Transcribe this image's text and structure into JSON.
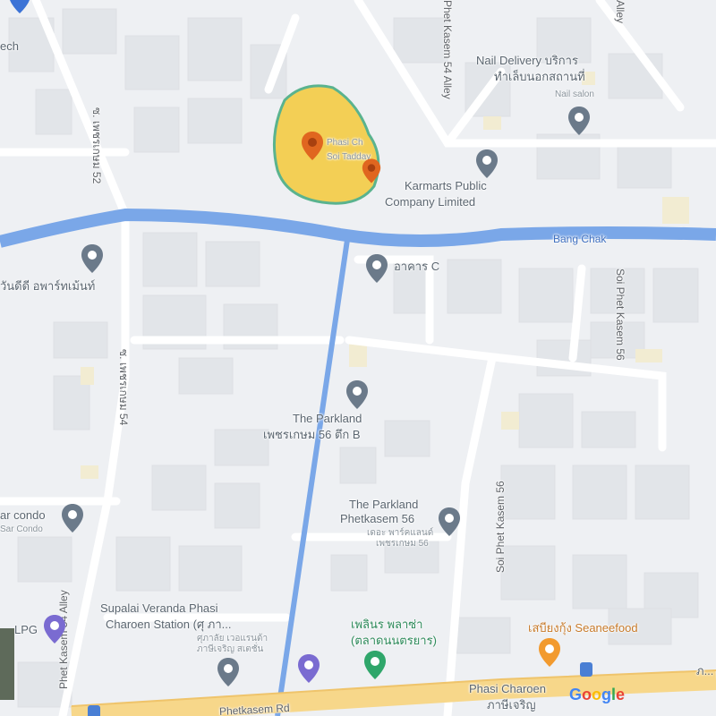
{
  "map": {
    "water_label": "Bang Chak",
    "roads": {
      "rd_bottom": "Phetkasem Rd",
      "soi_left": "Phet Kasem 54 Alley",
      "soi_left_th": "ซ. เพชรเกษม 54",
      "soi_top_th": "ซ. เพชรเกษม 52",
      "soi_right": "Soi Phet Kasem 56",
      "soi_right2": "Soi Phet Kasem 56",
      "soi_top_right": "Phet Kasem 54 Alley",
      "soi_top_right2": "Alley"
    },
    "places": {
      "tech_partial": "ech",
      "nail_delivery": "Nail Delivery บริการ",
      "nail_delivery_2": "ทำเล็บนอกสถานที่",
      "nail_salon": "Nail salon",
      "karmarts": "Karmarts Public",
      "karmarts_2": "Company Limited",
      "highlight_1": "Phasi Ch",
      "highlight_2": "Soi Tadday",
      "building_c": "อาคาร C",
      "left_th": "วันดีดี อพาร์ทเม้นท์",
      "parkland_b_1": "The Parkland",
      "parkland_b_2": "เพชรเกษม 56 ตึก B",
      "parkland_1": "The Parkland",
      "parkland_2": "Phetkasem 56",
      "parkland_3": "เดอะ พาร์คแลนด์",
      "parkland_4": "เพชรเกษม 56",
      "condo_1": "ar condo",
      "condo_2": "Sar Condo",
      "supalai_1": "Supalai Veranda Phasi",
      "supalai_2": "Charoen Station (ศุ ภา...",
      "supalai_3": "ศุภาลัย เวอแรนด้า",
      "supalai_4": "ภาษีเจริญ สเตชั่น",
      "lpg": "LPG",
      "market_1": "เพลินร พลาซ่า",
      "market_2": "(ตลาดนนตรยาร)",
      "seafood_1": "เสบียงกุ้ง Seaneefood",
      "phasi_station_1": "Phasi Charoen",
      "phasi_station_2": "ภาษีเจริญ",
      "google": "Google",
      "edge_th": "ภ..."
    },
    "colors": {
      "water": "#7aa7e8",
      "pin_grey": "#6b7a8a",
      "pin_orange": "#e0661f",
      "pin_food": "#f29a2e",
      "pin_green": "#2fa66a",
      "pin_purple": "#7a6bd1",
      "pin_blue": "#3c73d6",
      "highlight_fill": "#f3cf55",
      "highlight_border": "#5ab38e",
      "main_road": "#f7d78a"
    }
  }
}
